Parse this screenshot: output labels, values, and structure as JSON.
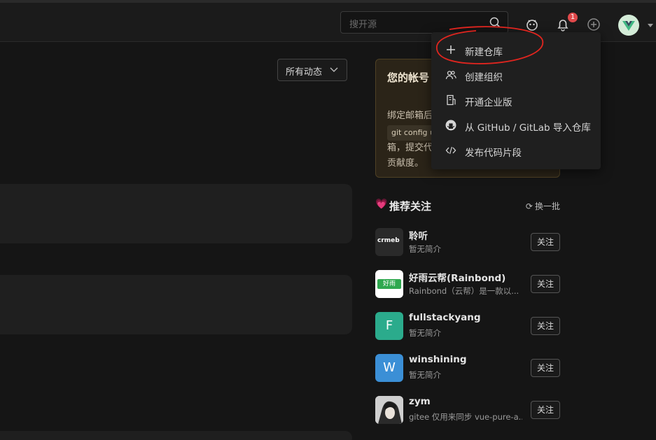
{
  "header": {
    "search_placeholder": "搜开源",
    "notification_count": "1"
  },
  "feed": {
    "filter_label": "所有动态"
  },
  "notice": {
    "title": "您的帐号 点此添加",
    "body_line1": "绑定邮箱后",
    "code": "git config u",
    "body_line3": "箱，提交代",
    "body_line4": "贡献度。"
  },
  "new_menu": {
    "items": [
      {
        "label": "新建仓库",
        "icon": "plus-icon"
      },
      {
        "label": "创建组织",
        "icon": "group-icon"
      },
      {
        "label": "开通企业版",
        "icon": "building-icon"
      },
      {
        "label": "从 GitHub / GitLab 导入仓库",
        "icon": "github-icon"
      },
      {
        "label": "发布代码片段",
        "icon": "code-icon"
      }
    ]
  },
  "recommend": {
    "heart": "💗",
    "title": "推荐关注",
    "refresh_label": "换一批",
    "follow_label": "关注",
    "users": [
      {
        "name": "聆听",
        "desc": "暂无简介",
        "avatar": "crmeb-logo",
        "avatar_text": "crmeb"
      },
      {
        "name": "好雨云帮(Rainbond)",
        "desc": "Rainbond（云帮）是一款以...",
        "avatar": "rainbond-logo",
        "avatar_text": "好雨"
      },
      {
        "name": "fullstackyang",
        "desc": "暂无简介",
        "avatar": "letter",
        "avatar_text": "F",
        "color": "#2bab8c"
      },
      {
        "name": "winshining",
        "desc": "暂无简介",
        "avatar": "letter",
        "avatar_text": "W",
        "color": "#3b8fd6"
      },
      {
        "name": "zym",
        "desc": "gitee 仅用来同步 vue-pure-a...",
        "avatar": "photo"
      }
    ]
  },
  "colors": {
    "background": "#151515",
    "annotation_red": "#e0251f",
    "badge": "#e0494b"
  }
}
